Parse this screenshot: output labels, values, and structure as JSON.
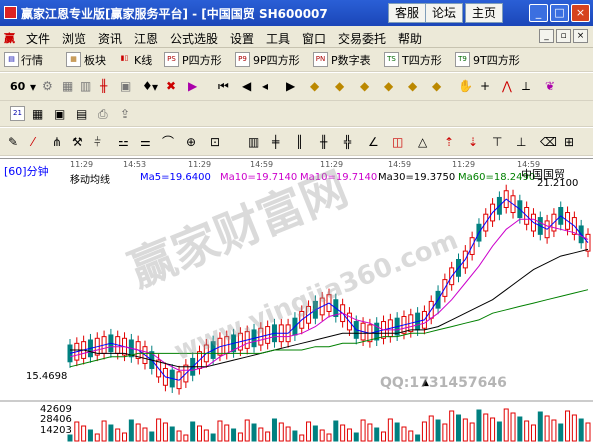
{
  "window": {
    "title": "赢家江恩专业版[赢家服务平台] - [中国国贸   SH600007",
    "buttons": [
      "客服",
      "论坛",
      "主页"
    ],
    "controls": [
      "_",
      "□",
      "×"
    ]
  },
  "menu": {
    "items": [
      "文件",
      "浏览",
      "资讯",
      "江恩",
      "公式选股",
      "设置",
      "工具",
      "窗口",
      "交易委托",
      "帮助"
    ],
    "mdi_controls": [
      "_",
      "▫",
      "×"
    ]
  },
  "toolbar1": {
    "items": [
      {
        "icon": "quote-icon",
        "label": "行情"
      },
      {
        "icon": "sector-icon",
        "label": "板块"
      },
      {
        "icon": "kline-icon",
        "label": "K线"
      },
      {
        "icon_text": "PS",
        "label": "P四方形"
      },
      {
        "icon_text": "P9",
        "label": "9P四方形"
      },
      {
        "icon_text": "PN",
        "label": "P数字表"
      },
      {
        "icon_text": "TS",
        "label": "T四方形"
      },
      {
        "icon_text": "T9",
        "label": "9T四方形"
      }
    ]
  },
  "toolbar2": {
    "period_select": "60"
  },
  "chart": {
    "period_label": "[60]分钟",
    "stock_name": "中国国贸",
    "indicator_title": "移动均线",
    "legend": [
      {
        "text": "Ma5=19.6400",
        "color": "#0000ff"
      },
      {
        "text": "Ma10=19.7140",
        "color": "#cc00cc"
      },
      {
        "text": "Ma10=19.7140",
        "color": "#cc00cc"
      },
      {
        "text": "Ma30=19.3750",
        "color": "#000000"
      },
      {
        "text": "Ma60=18.2490",
        "color": "#008000"
      }
    ],
    "time_ticks": [
      "11:29",
      "14:53",
      "11:29",
      "14:59",
      "11:29",
      "14:59",
      "11:29",
      "14:59"
    ],
    "high_label": "21.2100",
    "low_label": "15.4698",
    "volume_labels": [
      "42609",
      "28406",
      "14203"
    ]
  },
  "watermark": {
    "brand": "赢家财富网",
    "url": "www.yingjia360.com",
    "qq": "QQ:1731457646"
  },
  "chart_data": {
    "type": "candlestick",
    "series": [
      {
        "name": "Ma5",
        "color": "#0000ff",
        "values": [
          16.3,
          16.4,
          16.5,
          16.6,
          16.5,
          16.4,
          16.1,
          15.6,
          15.5,
          15.9,
          16.3,
          16.5,
          16.6,
          16.7,
          16.8,
          16.9,
          16.9,
          17.3,
          17.6,
          17.8,
          17.5,
          17.0,
          16.9,
          17.0,
          17.1,
          17.2,
          17.3,
          17.9,
          18.6,
          19.1,
          19.9,
          20.5,
          20.9,
          20.6,
          20.2,
          20.0,
          20.4,
          20.1,
          19.6
        ]
      },
      {
        "name": "Ma10",
        "color": "#cc00cc",
        "values": [
          16.2,
          16.3,
          16.4,
          16.5,
          16.5,
          16.4,
          16.3,
          16.0,
          15.8,
          15.8,
          15.9,
          16.2,
          16.4,
          16.6,
          16.7,
          16.8,
          16.8,
          16.9,
          17.1,
          17.4,
          17.5,
          17.3,
          17.2,
          17.0,
          17.0,
          17.1,
          17.2,
          17.5,
          17.9,
          18.4,
          18.9,
          19.5,
          20.0,
          20.3,
          20.3,
          20.1,
          20.0,
          19.9,
          19.7
        ]
      },
      {
        "name": "Ma30",
        "color": "#000000",
        "values": [
          16.4,
          16.4,
          16.3,
          16.3,
          16.3,
          16.2,
          16.1,
          16.0,
          15.9,
          15.9,
          15.9,
          16.0,
          16.1,
          16.2,
          16.3,
          16.4,
          16.5,
          16.6,
          16.7,
          16.8,
          16.9,
          16.9,
          16.9,
          16.9,
          16.9,
          17.0,
          17.0,
          17.1,
          17.3,
          17.5,
          17.7,
          17.9,
          18.2,
          18.5,
          18.8,
          19.0,
          19.2,
          19.3,
          19.4
        ]
      },
      {
        "name": "Ma60",
        "color": "#008000",
        "values": [
          15.9,
          16.0,
          16.1,
          16.2,
          16.2,
          16.3,
          16.3,
          16.3,
          16.3,
          16.3,
          16.3,
          16.3,
          16.3,
          16.3,
          16.3,
          16.4,
          16.4,
          16.4,
          16.5,
          16.5,
          16.6,
          16.6,
          16.7,
          16.8,
          16.8,
          16.9,
          16.9,
          17.0,
          17.1,
          17.2,
          17.3,
          17.5,
          17.6,
          17.7,
          17.8,
          17.9,
          18.0,
          18.1,
          18.2
        ]
      }
    ],
    "ylim": [
      15.0,
      21.5
    ],
    "volume_ylim": [
      0,
      42609
    ]
  }
}
